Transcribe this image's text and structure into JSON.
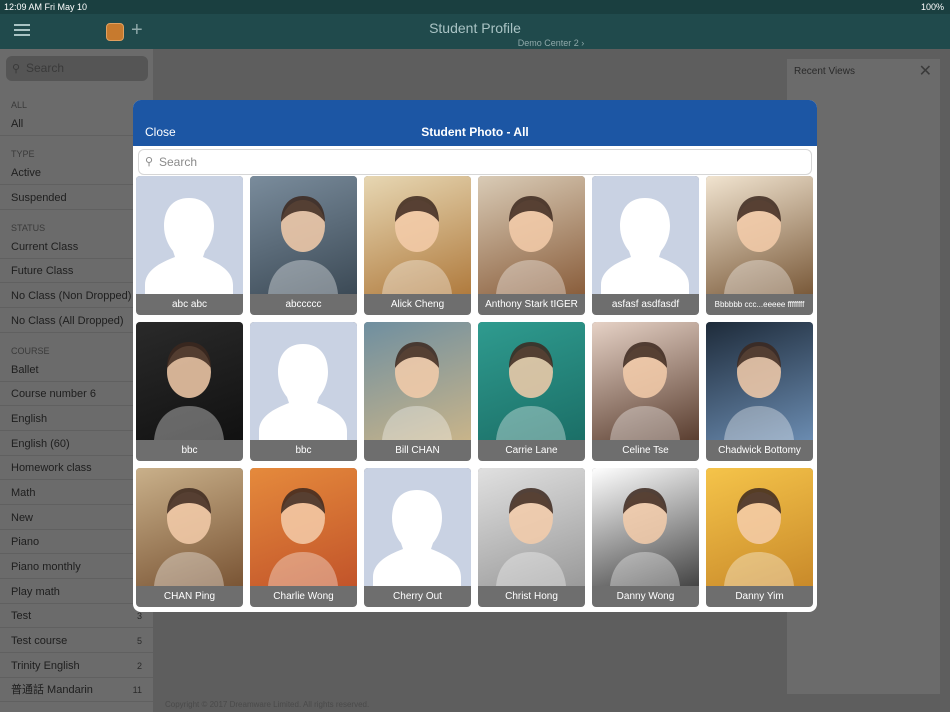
{
  "status": {
    "time": "12:09 AM  Fri May 10",
    "battery": "100%"
  },
  "header": {
    "title": "Student Profile",
    "subtitle": "Demo Center 2 ›"
  },
  "sidebar": {
    "search_placeholder": "Search",
    "sections": [
      "ALL",
      "TYPE",
      "STATUS",
      "COURSE"
    ],
    "items": [
      {
        "label": "All",
        "count": ""
      },
      {
        "label": "Active",
        "count": ""
      },
      {
        "label": "Suspended",
        "count": ""
      },
      {
        "label": "Current Class",
        "count": ""
      },
      {
        "label": "Future Class",
        "count": ""
      },
      {
        "label": "No Class (Non Dropped)",
        "count": ""
      },
      {
        "label": "No Class (All Dropped)",
        "count": ""
      },
      {
        "label": "Ballet",
        "count": ""
      },
      {
        "label": "Course number 6",
        "count": ""
      },
      {
        "label": "English",
        "count": ""
      },
      {
        "label": "English (60)",
        "count": ""
      },
      {
        "label": "Homework class",
        "count": ""
      },
      {
        "label": "Math",
        "count": ""
      },
      {
        "label": "New",
        "count": ""
      },
      {
        "label": "Piano",
        "count": ""
      },
      {
        "label": "Piano monthly",
        "count": ""
      },
      {
        "label": "Play math",
        "count": ""
      },
      {
        "label": "Test",
        "count": "3"
      },
      {
        "label": "Test course",
        "count": "5"
      },
      {
        "label": "Trinity English",
        "count": "2"
      },
      {
        "label": "普通話 Mandarin",
        "count": "11"
      }
    ]
  },
  "recent": {
    "label": "Recent Views"
  },
  "footer": {
    "text": "Copyright © 2017 Dreamware Limited. All rights reserved."
  },
  "modal": {
    "close_label": "Close",
    "title": "Student Photo - All",
    "search_placeholder": "Search",
    "students": [
      {
        "name": "abc abc",
        "photo": "placeholder"
      },
      {
        "name": "abccccc",
        "photo": "photo"
      },
      {
        "name": "Alick Cheng",
        "photo": "photo"
      },
      {
        "name": "Anthony Stark tIGER",
        "photo": "photo"
      },
      {
        "name": "asfasf asdfasdf",
        "photo": "placeholder"
      },
      {
        "name": "Bbbbbb ccc...eeeee ffffffff",
        "photo": "photo"
      },
      {
        "name": "bbc",
        "photo": "photo"
      },
      {
        "name": "bbc",
        "photo": "placeholder"
      },
      {
        "name": "Bill CHAN",
        "photo": "photo"
      },
      {
        "name": "Carrie Lane",
        "photo": "photo"
      },
      {
        "name": "Celine Tse",
        "photo": "photo"
      },
      {
        "name": "Chadwick Bottomy",
        "photo": "photo"
      },
      {
        "name": "CHAN Ping",
        "photo": "photo"
      },
      {
        "name": "Charlie Wong",
        "photo": "photo"
      },
      {
        "name": "Cherry Out",
        "photo": "placeholder"
      },
      {
        "name": "Christ Hong",
        "photo": "photo"
      },
      {
        "name": "Danny Wong",
        "photo": "photo"
      },
      {
        "name": "Danny Yim",
        "photo": "photo"
      }
    ]
  }
}
